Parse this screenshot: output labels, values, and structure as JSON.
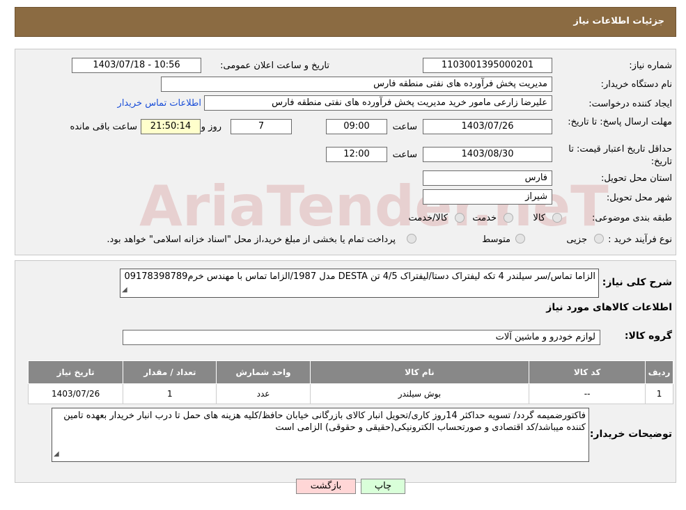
{
  "header": {
    "title": "جزئیات اطلاعات نیاز"
  },
  "form": {
    "need_number_label": "شماره نیاز:",
    "need_number": "1103001395000201",
    "announce_label": "تاریخ و ساعت اعلان عمومی:",
    "announce_value": "1403/07/18 - 10:56",
    "buyer_org_label": "نام دستگاه خریدار:",
    "buyer_org": "مدیریت پخش فرآورده های نفتی منطقه فارس",
    "creator_label": "ایجاد کننده درخواست:",
    "creator": "علیرضا زارعی مامور خرید مدیریت پخش فرآورده های نفتی منطقه فارس",
    "contact_link": "اطلاعات تماس خریدار",
    "deadline_label": "مهلت ارسال پاسخ: تا تاریخ:",
    "deadline_date": "1403/07/26",
    "time_label": "ساعت",
    "deadline_time": "09:00",
    "days_value": "7",
    "days_label": "روز و",
    "remaining_time": "21:50:14",
    "remaining_label": "ساعت باقی مانده",
    "validity_label": "حداقل تاریخ اعتبار قیمت: تا تاریخ:",
    "validity_date": "1403/08/30",
    "validity_time": "12:00",
    "province_label": "استان محل تحویل:",
    "province": "فارس",
    "city_label": "شهر محل تحویل:",
    "city": "شیراز",
    "category_label": "طبقه بندی موضوعی:",
    "category_options": [
      "کالا",
      "خدمت",
      "کالا/خدمت"
    ],
    "process_label": "نوع فرآیند خرید :",
    "process_options": [
      "جزیی",
      "متوسط"
    ],
    "process_note": "پرداخت تمام یا بخشی از مبلغ خرید،از محل \"اسناد خزانه اسلامی\" خواهد بود."
  },
  "description": {
    "label": "شرح کلی نیاز:",
    "text": "الزاما تماس/سر سیلندر 4 تکه لیفتراک دستا/لیفتراک 4/5 تن DESTA مدل 1987/الزاما تماس با مهندس خرم09178398789"
  },
  "goods": {
    "section_title": "اطلاعات کالاهای مورد نیاز",
    "group_label": "گروه کالا:",
    "group_value": "لوازم خودرو و ماشین آلات",
    "columns": [
      "ردیف",
      "کد کالا",
      "نام کالا",
      "واحد شمارش",
      "تعداد / مقدار",
      "تاریخ نیاز"
    ],
    "rows": [
      [
        "1",
        "--",
        "بوش سیلندر",
        "عدد",
        "1",
        "1403/07/26"
      ]
    ]
  },
  "buyer_notes": {
    "label": "توضیحات خریدار:",
    "text": "فاکتورضمیمه گردد/ تسویه حداکثر 14روز کاری/تحویل انبار کالای بازرگانی خیابان حافظ/کلیه هزینه های حمل تا درب انبار خریدار بعهده تامین کننده میباشد/کد اقتصادی و صورتحساب الکترونیکی(حقیقی و حقوقی) الزامی است"
  },
  "buttons": {
    "back": "بازگشت",
    "print": "چاپ"
  },
  "watermark": "AriaTender.neT",
  "colors": {
    "header": "#8B6B42",
    "table_header": "#888888",
    "back_button": "#ffd6d6",
    "print_button": "#d9ffd9"
  }
}
